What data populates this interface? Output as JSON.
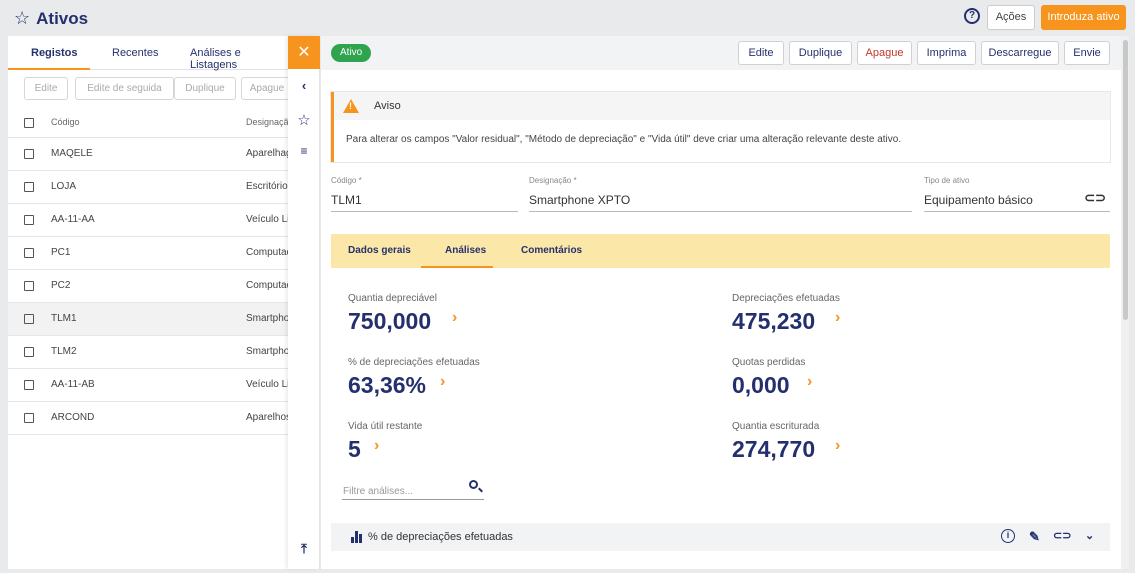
{
  "header": {
    "title": "Ativos",
    "acoes_label": "Ações",
    "introduza_label": "Introduza ativo"
  },
  "left": {
    "tabs": [
      "Registos",
      "Recentes",
      "Análises e Listagens"
    ],
    "actions": [
      "Edite",
      "Edite de seguida",
      "Duplique",
      "Apague"
    ],
    "columns": {
      "code": "Código",
      "designation": "Designação"
    },
    "rows": [
      {
        "code": "MAQELE",
        "desig": "Aparelhag"
      },
      {
        "code": "LOJA",
        "desig": "Escritório"
      },
      {
        "code": "AA-11-AA",
        "desig": "Veículo Li"
      },
      {
        "code": "PC1",
        "desig": "Computad"
      },
      {
        "code": "PC2",
        "desig": "Computad"
      },
      {
        "code": "TLM1",
        "desig": "Smartpho"
      },
      {
        "code": "TLM2",
        "desig": "Smartpho"
      },
      {
        "code": "AA-11-AB",
        "desig": "Veículo Li"
      },
      {
        "code": "ARCOND",
        "desig": "Aparelhos"
      }
    ]
  },
  "main": {
    "status": "Ativo",
    "buttons": [
      "Edite",
      "Duplique",
      "Apague",
      "Imprima",
      "Descarregue",
      "Envie"
    ],
    "warning": {
      "title": "Aviso",
      "text": "Para alterar os campos \"Valor residual\", \"Método de depreciação\" e \"Vida útil\" deve criar uma alteração relevante deste ativo."
    },
    "fields": {
      "code_label": "Código *",
      "code_value": "TLM1",
      "desig_label": "Designação *",
      "desig_value": "Smartphone XPTO",
      "type_label": "Tipo de ativo",
      "type_value": "Equipamento básico"
    },
    "tabs": [
      "Dados gerais",
      "Análises",
      "Comentários"
    ],
    "metrics": [
      {
        "label": "Quantia depreciável",
        "value": "750,000"
      },
      {
        "label": "Depreciações efetuadas",
        "value": "475,230"
      },
      {
        "label": "% de depreciações efetuadas",
        "value": "63,36%"
      },
      {
        "label": "Quotas perdidas",
        "value": "0,000"
      },
      {
        "label": "Vida útil restante",
        "value": "5"
      },
      {
        "label": "Quantia escriturada",
        "value": "274,770"
      }
    ],
    "filter_placeholder": "Filtre análises...",
    "chart_row_title": "% de depreciações efetuadas"
  },
  "colors": {
    "accent": "#f7941d",
    "brand": "#24306e",
    "active_badge": "#2ea44f",
    "tab_bar": "#fbe7a7"
  }
}
